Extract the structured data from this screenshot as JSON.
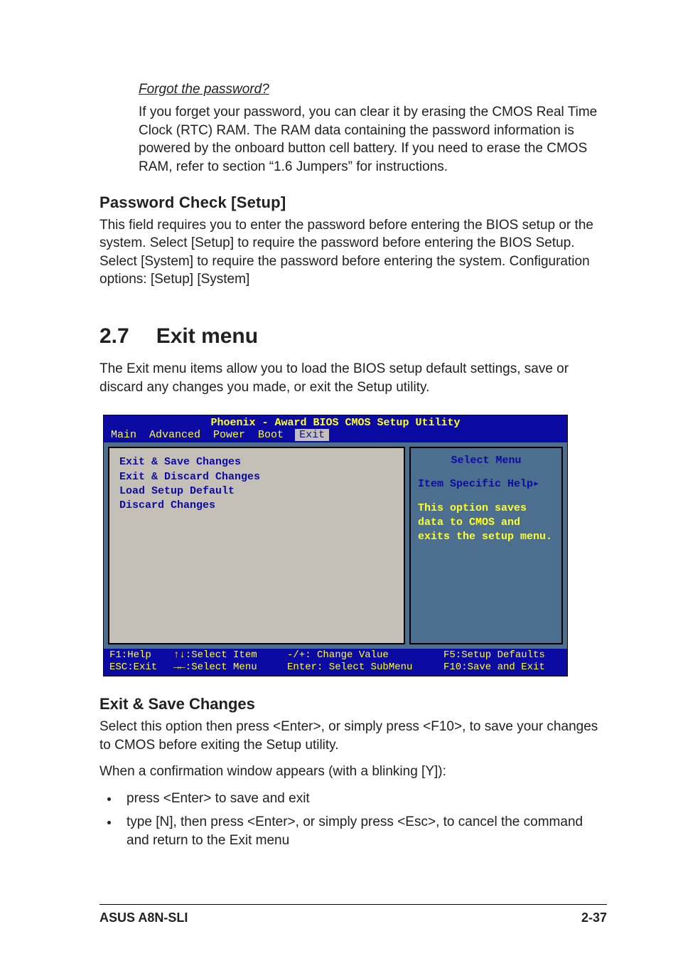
{
  "forgot": {
    "title": "Forgot the password?",
    "body": "If you forget your password, you can clear it by erasing the CMOS Real Time Clock (RTC) RAM. The RAM data containing the password information is powered by the onboard button cell battery. If you need to erase the CMOS RAM, refer to section “1.6 Jumpers” for instructions."
  },
  "password_check": {
    "heading": "Password Check [Setup]",
    "body": "This field requires you to enter the password before entering the BIOS setup or the system. Select [Setup] to require the password before entering the BIOS Setup. Select [System] to require the password before entering the system. Configuration options: [Setup] [System]"
  },
  "exit_menu": {
    "num": "2.7",
    "title": "Exit menu",
    "intro": "The Exit menu items allow you to load the BIOS setup default settings, save or discard any changes you made, or exit the Setup utility."
  },
  "bios": {
    "title": "Phoenix - Award BIOS CMOS Setup Utility",
    "tabs": [
      "Main",
      "Advanced",
      "Power",
      "Boot",
      "Exit"
    ],
    "active_tab": "Exit",
    "left_items": [
      "Exit & Save Changes",
      "Exit & Discard Changes",
      "Load Setup Default",
      "Discard Changes"
    ],
    "right": {
      "select_menu": "Select Menu",
      "help_label": "Item Specific Help▸",
      "help_text": "This option saves data to CMOS and exits the setup menu."
    },
    "footer": {
      "r1c1": "F1:Help",
      "r1c2": "↑↓:Select Item",
      "r1c3": "-/+: Change Value",
      "r1c4": "F5:Setup Defaults",
      "r2c1": "ESC:Exit",
      "r2c2": "→←:Select Menu",
      "r2c3": "Enter: Select SubMenu",
      "r2c4": "F10:Save and Exit"
    }
  },
  "exit_save": {
    "heading": "Exit & Save Changes",
    "p1": "Select this option then press <Enter>, or simply press <F10>, to save your changes to CMOS before exiting the Setup utility.",
    "p2": "When a confirmation window appears (with a blinking [Y]):",
    "b1": "press <Enter> to save and exit",
    "b2": "type [N], then press <Enter>, or simply press <Esc>, to cancel the command and return to the Exit menu"
  },
  "footer": {
    "left": "ASUS A8N-SLI",
    "right": "2-37"
  }
}
